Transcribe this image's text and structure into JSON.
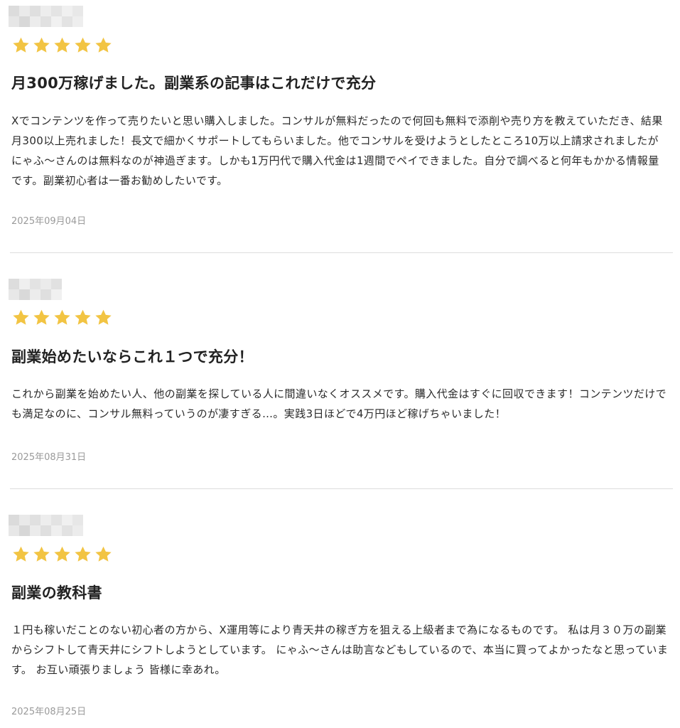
{
  "star_color": "#F2C443",
  "reviews": [
    {
      "rating": 5,
      "title": "月300万稼げました。副業系の記事はこれだけで充分",
      "body": "Xでコンテンツを作って売りたいと思い購入しました。コンサルが無料だったので何回も無料で添削や売り方を教えていただき、結果月300以上売れました！長文で細かくサポートしてもらいました。他でコンサルを受けようとしたところ10万以上請求されましたがにゃふ〜さんのは無料なのが神過ぎます。しかも1万円代で購入代金は1週間でペイできました。自分で調べると何年もかかる情報量です。副業初心者は一番お勧めしたいです。",
      "date": "2025年09月04日"
    },
    {
      "rating": 5,
      "title": "副業始めたいならこれ１つで充分！",
      "body": "これから副業を始めたい人、他の副業を探している人に間違いなくオススメです。購入代金はすぐに回収できます！コンテンツだけでも満足なのに、コンサル無料っていうのが凄すぎる…。実践3日ほどで4万円ほど稼げちゃいました！",
      "date": "2025年08月31日"
    },
    {
      "rating": 5,
      "title": "副業の教科書",
      "body": "１円も稼いだことのない初心者の方から、X運用等により青天井の稼ぎ方を狙える上級者まで為になるものです。 私は月３０万の副業からシフトして青天井にシフトしようとしています。 にゃふ〜さんは助言などもしているので、本当に買ってよかったなと思っています。 お互い頑張りましょう 皆様に幸あれ。",
      "date": "2025年08月25日"
    }
  ]
}
